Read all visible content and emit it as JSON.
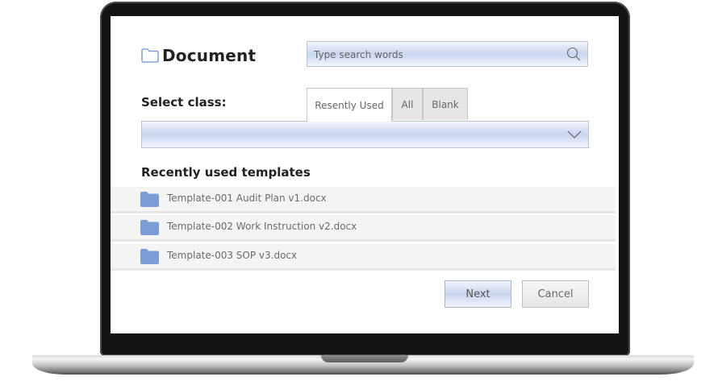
{
  "dialog": {
    "title": "Document",
    "search": {
      "placeholder": "Type search words"
    },
    "select_class_label": "Select class:",
    "tabs": [
      {
        "label": "Resently Used",
        "active": true
      },
      {
        "label": "All",
        "active": false
      },
      {
        "label": "Blank",
        "active": false
      }
    ],
    "class_dropdown": {
      "selected": ""
    },
    "recent_templates_title": "Recently used templates",
    "templates": [
      {
        "name": "Template-001 Audit Plan v1.docx",
        "icon": "folder-icon"
      },
      {
        "name": "Template-002 Work Instruction v2.docx",
        "icon": "folder-icon"
      },
      {
        "name": "Template-003 SOP v3.docx",
        "icon": "folder-icon"
      }
    ],
    "buttons": {
      "next": "Next",
      "cancel": "Cancel"
    }
  },
  "colors": {
    "accent_gradient_mid": "#c9d6ef",
    "folder_blue": "#7b9dd6",
    "laptop_bezel": "#141414"
  }
}
